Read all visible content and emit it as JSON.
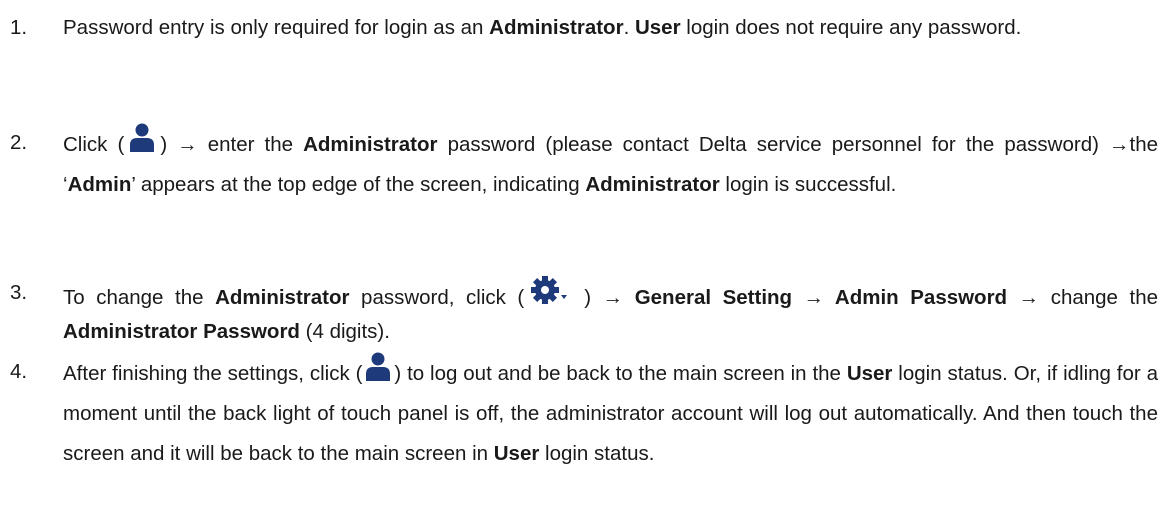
{
  "items": [
    {
      "number": "1.",
      "parts": {
        "a": "Password entry is only required for login as an ",
        "b": "Administrator",
        "c": ". ",
        "d": "User",
        "e": " login does not require any password."
      }
    },
    {
      "number": "2.",
      "parts": {
        "a": "Click (",
        "icon": "user-icon",
        "b": ") → enter the ",
        "c": "Administrator",
        "d": " password (please contact Delta service personnel for the password) →the ‘",
        "e": "Admin",
        "f": "’ appears at the top edge of the screen, indicating ",
        "g": "Administrator",
        "h": " login is successful."
      }
    },
    {
      "number": "3.",
      "parts": {
        "a": "To change the ",
        "b": "Administrator",
        "c": " password, click (",
        "icon": "gear-dropdown-icon",
        "d": ") → ",
        "e": "General Setting → Admin Password",
        "f": " → change the ",
        "g": "Administrator Password",
        "h": " (4 digits)."
      }
    },
    {
      "number": "4.",
      "parts": {
        "a": "After finishing the settings, click (",
        "icon": "user-icon",
        "b": ") to log out and be back to the main screen in the ",
        "c": "User",
        "d": " login status. Or, if idling for a moment until the back light of touch panel is off, the administrator account will log out automatically. And then touch the screen and it will be back to the main screen in ",
        "e": "User",
        "f": " login status."
      }
    }
  ],
  "icon_color": "#1f3a7a"
}
